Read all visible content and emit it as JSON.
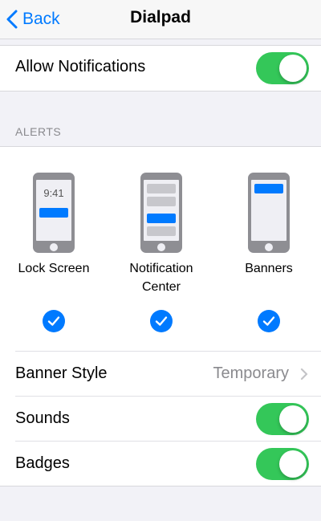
{
  "navbar": {
    "back_label": "Back",
    "title": "Dialpad"
  },
  "allow_notifications": {
    "label": "Allow Notifications",
    "enabled": true
  },
  "alerts": {
    "header": "ALERTS",
    "options": [
      {
        "label": "Lock Screen",
        "time": "9:41",
        "checked": true,
        "icon": "lock-screen-phone-icon"
      },
      {
        "label": "Notification Center",
        "checked": true,
        "icon": "notification-center-phone-icon"
      },
      {
        "label": "Banners",
        "checked": true,
        "icon": "banners-phone-icon"
      }
    ]
  },
  "banner_style": {
    "label": "Banner Style",
    "value": "Temporary"
  },
  "sounds": {
    "label": "Sounds",
    "enabled": true
  },
  "badges": {
    "label": "Badges",
    "enabled": true
  },
  "colors": {
    "accent": "#007aff",
    "toggle_on": "#34c759",
    "background": "#f2f2f7"
  }
}
